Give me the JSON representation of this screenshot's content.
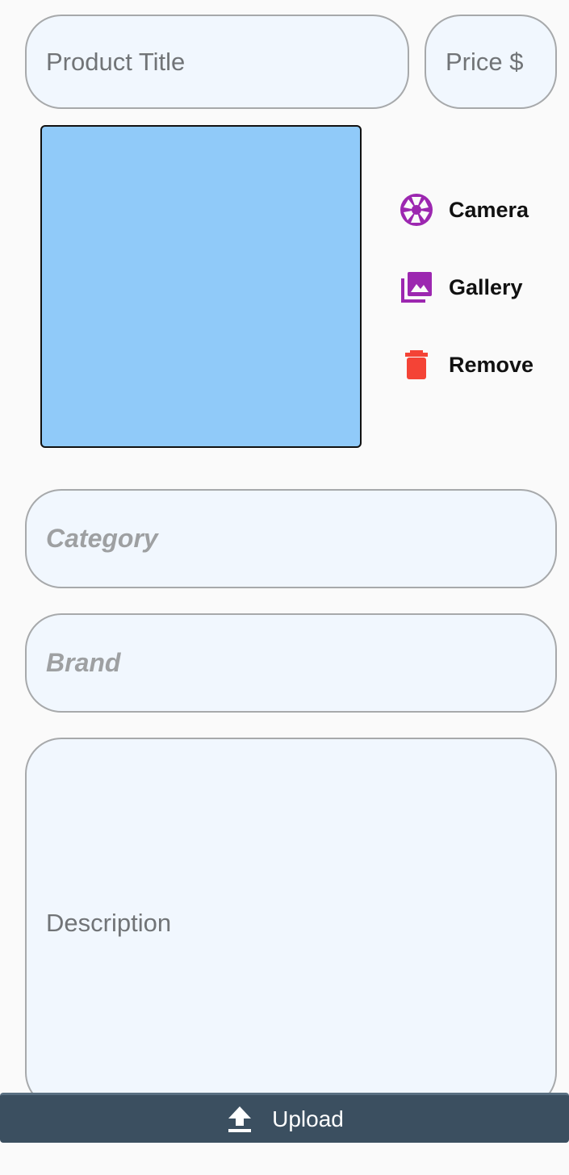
{
  "form": {
    "title_placeholder": "Product Title",
    "price_placeholder": "Price $",
    "category_placeholder": "Category",
    "brand_placeholder": "Brand",
    "description_placeholder": "Description"
  },
  "image_actions": {
    "camera": {
      "label": "Camera",
      "icon": "camera-shutter-icon",
      "color": "#9c27b0"
    },
    "gallery": {
      "label": "Gallery",
      "icon": "photo-library-icon",
      "color": "#9c27b0"
    },
    "remove": {
      "label": "Remove",
      "icon": "trash-icon",
      "color": "#f44336"
    }
  },
  "image_preview": {
    "color": "#90caf9"
  },
  "upload": {
    "label": "Upload",
    "icon": "upload-icon",
    "background": "#3b4f60"
  }
}
